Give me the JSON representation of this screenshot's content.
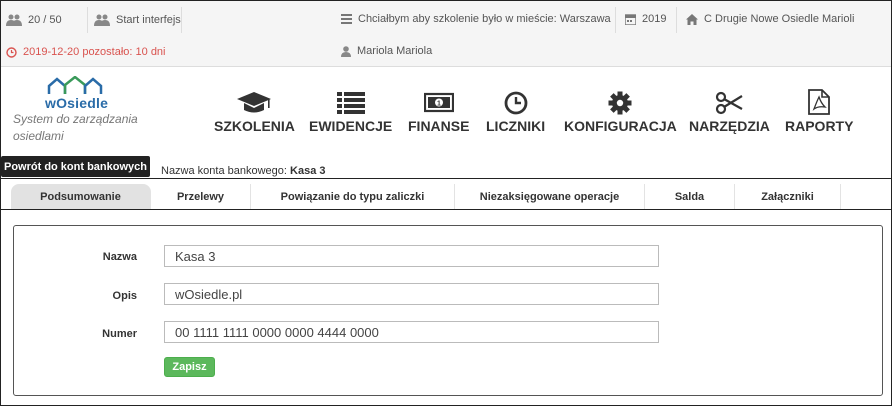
{
  "topbar": {
    "user_count": "20 / 50",
    "start_label": "Start interfejs",
    "wish_text": "Chciałbym aby szkolenie było w mieście: Warszawa",
    "year": "2019",
    "location": "C Drugie Nowe Osiedle Marioli",
    "expiry_text": "2019-12-20 pozostało: 10 dni",
    "user_name": "Mariola Mariola"
  },
  "logo": {
    "brand": "wOsiedle",
    "subtitle": "System do zarządzania osiedlami"
  },
  "nav": [
    {
      "label": "SZKOLENIA",
      "icon": "graduation-cap-icon"
    },
    {
      "label": "EWIDENCJE",
      "icon": "list-icon"
    },
    {
      "label": "FINANSE",
      "icon": "money-icon"
    },
    {
      "label": "LICZNIKI",
      "icon": "clock-icon"
    },
    {
      "label": "KONFIGURACJA",
      "icon": "gear-icon"
    },
    {
      "label": "NARZĘDZIA",
      "icon": "scissors-icon"
    },
    {
      "label": "RAPORTY",
      "icon": "pdf-file-icon"
    }
  ],
  "back_button": "Powrót do kont bankowych",
  "account": {
    "label": "Nazwa konta bankowego:",
    "value": "Kasa 3"
  },
  "tabs": [
    {
      "label": "Podsumowanie",
      "active": true
    },
    {
      "label": "Przelewy"
    },
    {
      "label": "Powiązanie do typu zaliczki"
    },
    {
      "label": "Niezaksięgowane operacje"
    },
    {
      "label": "Salda"
    },
    {
      "label": "Załączniki"
    }
  ],
  "form": {
    "name_label": "Nazwa",
    "name_value": "Kasa 3",
    "desc_label": "Opis",
    "desc_value": "wOsiedle.pl",
    "number_label": "Numer",
    "number_value": "00 1111 1111 0000 0000 4444 0000",
    "save_label": "Zapisz"
  }
}
